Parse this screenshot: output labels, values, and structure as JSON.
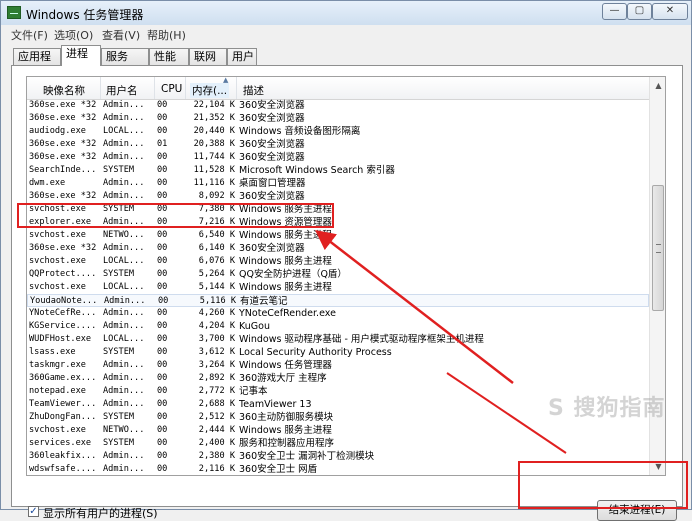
{
  "window": {
    "title": "Windows 任务管理器",
    "controls": {
      "minimize": "—",
      "maximize": "▢",
      "close": "✕"
    }
  },
  "menu": [
    "文件(F)",
    "选项(O)",
    "查看(V)",
    "帮助(H)"
  ],
  "tabs": [
    "应用程序",
    "进程",
    "服务",
    "性能",
    "联网",
    "用户"
  ],
  "active_tab": "进程",
  "columns": {
    "image": "映像名称",
    "user": "用户名",
    "cpu": "CPU",
    "memory": "内存(...",
    "desc": "描述"
  },
  "rows": [
    {
      "name": "360se.exe *32",
      "user": "Admin...",
      "cpu": "00",
      "mem": "22,104 K",
      "desc": "360安全浏览器"
    },
    {
      "name": "360se.exe *32",
      "user": "Admin...",
      "cpu": "00",
      "mem": "21,352 K",
      "desc": "360安全浏览器"
    },
    {
      "name": "audiodg.exe",
      "user": "LOCAL...",
      "cpu": "00",
      "mem": "20,440 K",
      "desc": "Windows 音频设备图形隔离"
    },
    {
      "name": "360se.exe *32",
      "user": "Admin...",
      "cpu": "01",
      "mem": "20,388 K",
      "desc": "360安全浏览器"
    },
    {
      "name": "360se.exe *32",
      "user": "Admin...",
      "cpu": "00",
      "mem": "11,744 K",
      "desc": "360安全浏览器"
    },
    {
      "name": "SearchInde...",
      "user": "SYSTEM",
      "cpu": "00",
      "mem": "11,528 K",
      "desc": "Microsoft Windows Search 索引器"
    },
    {
      "name": "dwm.exe",
      "user": "Admin...",
      "cpu": "00",
      "mem": "11,116 K",
      "desc": "桌面窗口管理器"
    },
    {
      "name": "360se.exe *32",
      "user": "Admin...",
      "cpu": "00",
      "mem": "8,092 K",
      "desc": "360安全浏览器"
    },
    {
      "name": "svchost.exe",
      "user": "SYSTEM",
      "cpu": "00",
      "mem": "7,380 K",
      "desc": "Windows 服务主进程"
    },
    {
      "name": "explorer.exe",
      "user": "Admin...",
      "cpu": "00",
      "mem": "7,216 K",
      "desc": "Windows 资源管理器"
    },
    {
      "name": "svchost.exe",
      "user": "NETWO...",
      "cpu": "00",
      "mem": "6,540 K",
      "desc": "Windows 服务主进程"
    },
    {
      "name": "360se.exe *32",
      "user": "Admin...",
      "cpu": "00",
      "mem": "6,140 K",
      "desc": "360安全浏览器"
    },
    {
      "name": "svchost.exe",
      "user": "LOCAL...",
      "cpu": "00",
      "mem": "6,076 K",
      "desc": "Windows 服务主进程"
    },
    {
      "name": "QQProtect....",
      "user": "SYSTEM",
      "cpu": "00",
      "mem": "5,264 K",
      "desc": "QQ安全防护进程（Q盾）"
    },
    {
      "name": "svchost.exe",
      "user": "LOCAL...",
      "cpu": "00",
      "mem": "5,144 K",
      "desc": "Windows 服务主进程"
    },
    {
      "name": "YoudaoNote...",
      "user": "Admin...",
      "cpu": "00",
      "mem": "5,116 K",
      "desc": "有道云笔记"
    },
    {
      "name": "YNoteCefRe...",
      "user": "Admin...",
      "cpu": "00",
      "mem": "4,260 K",
      "desc": "YNoteCefRender.exe"
    },
    {
      "name": "KGService....",
      "user": "Admin...",
      "cpu": "00",
      "mem": "4,204 K",
      "desc": "KuGou"
    },
    {
      "name": "WUDFHost.exe",
      "user": "LOCAL...",
      "cpu": "00",
      "mem": "3,700 K",
      "desc": "Windows 驱动程序基础 - 用户模式驱动程序框架主机进程"
    },
    {
      "name": "lsass.exe",
      "user": "SYSTEM",
      "cpu": "00",
      "mem": "3,612 K",
      "desc": "Local Security Authority Process"
    },
    {
      "name": "taskmgr.exe",
      "user": "Admin...",
      "cpu": "00",
      "mem": "3,264 K",
      "desc": "Windows 任务管理器"
    },
    {
      "name": "360Game.ex...",
      "user": "Admin...",
      "cpu": "00",
      "mem": "2,892 K",
      "desc": "360游戏大厅 主程序"
    },
    {
      "name": "notepad.exe",
      "user": "Admin...",
      "cpu": "00",
      "mem": "2,772 K",
      "desc": "记事本"
    },
    {
      "name": "TeamViewer...",
      "user": "Admin...",
      "cpu": "00",
      "mem": "2,688 K",
      "desc": "TeamViewer 13"
    },
    {
      "name": "ZhuDongFan...",
      "user": "SYSTEM",
      "cpu": "00",
      "mem": "2,512 K",
      "desc": "360主动防御服务模块"
    },
    {
      "name": "svchost.exe",
      "user": "NETWO...",
      "cpu": "00",
      "mem": "2,444 K",
      "desc": "Windows 服务主进程"
    },
    {
      "name": "services.exe",
      "user": "SYSTEM",
      "cpu": "00",
      "mem": "2,400 K",
      "desc": "服务和控制器应用程序"
    },
    {
      "name": "360leakfix...",
      "user": "Admin...",
      "cpu": "00",
      "mem": "2,380 K",
      "desc": "360安全卫士 漏洞补丁检测模块"
    },
    {
      "name": "wdswfsafe....",
      "user": "Admin...",
      "cpu": "00",
      "mem": "2,116 K",
      "desc": "360安全卫士 网盾"
    }
  ],
  "show_all_users": {
    "label": "显示所有用户的进程(S)",
    "checked": true
  },
  "end_process_button": "结束进程(E)",
  "watermark": "S 搜狗指南",
  "annotation_color": "#e02020"
}
